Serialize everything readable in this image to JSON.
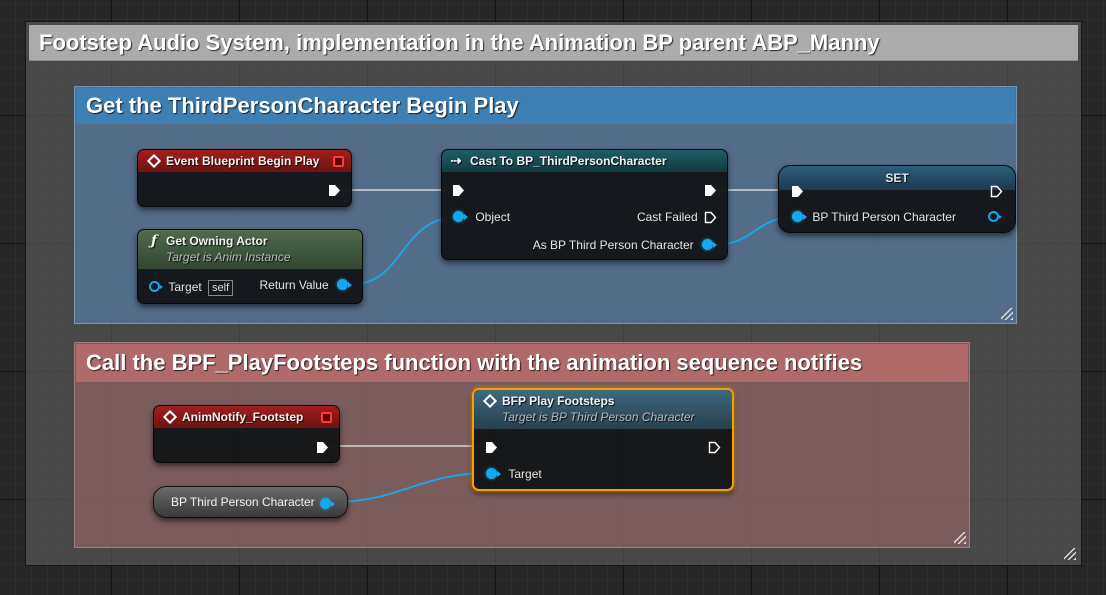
{
  "comments": {
    "outer": {
      "title": "Footstep Audio System, implementation in the Animation BP parent ABP_Manny",
      "color": "#ababab"
    },
    "begin_play": {
      "title": "Get the ThirdPersonCharacter Begin Play",
      "color": "#3e7fb4"
    },
    "footsteps": {
      "title": "Call the BPF_PlayFootsteps function with the animation sequence notifies",
      "color": "#b06a6a"
    }
  },
  "nodes": {
    "event_begin_play": {
      "title": "Event Blueprint Begin Play",
      "icon": "event-diamond-icon"
    },
    "get_owning_actor": {
      "title": "Get Owning Actor",
      "subtitle": "Target is Anim Instance",
      "icon": "function-icon",
      "icon_glyph": "ƒ",
      "target_label": "Target",
      "self_label": "self",
      "return_label": "Return Value"
    },
    "cast": {
      "title": "Cast To BP_ThirdPersonCharacter",
      "icon": "cast-icon",
      "icon_glyph": "⇢",
      "object_label": "Object",
      "cast_failed_label": "Cast Failed",
      "as_label": "As BP Third Person Character"
    },
    "set": {
      "title": "SET",
      "var_label": "BP Third Person Character"
    },
    "anim_notify": {
      "title": "AnimNotify_Footstep",
      "icon": "event-diamond-icon"
    },
    "bfp_play": {
      "title": "BFP Play Footsteps",
      "subtitle": "Target is BP Third Person Character",
      "icon": "function-call-icon",
      "target_label": "Target"
    },
    "var_getter": {
      "label": "BP Third Person Character"
    }
  },
  "colors": {
    "exec_wire": "#d8d8d8",
    "object_pin": "#15a8f0",
    "event_header": "#a11e1e",
    "selection": "#f5a000"
  }
}
